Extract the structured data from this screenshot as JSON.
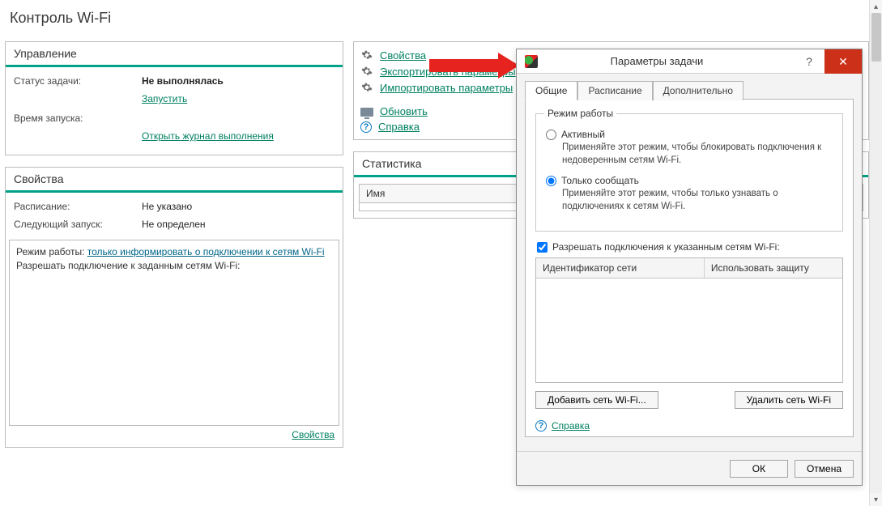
{
  "page_title": "Контроль Wi-Fi",
  "management": {
    "title": "Управление",
    "status_label": "Статус задачи:",
    "status_value": "Не выполнялась",
    "run_link": "Запустить",
    "start_label": "Время запуска:",
    "log_link": "Открыть журнал выполнения"
  },
  "properties_panel": {
    "title": "Свойства",
    "schedule_label": "Расписание:",
    "schedule_value": "Не указано",
    "next_label": "Следующий запуск:",
    "next_value": "Не определен",
    "mode_prefix": "Режим работы: ",
    "mode_value": "только информировать о подключении к сетям Wi-Fi",
    "allow_line": "Разрешать подключение к заданным сетям Wi-Fi:",
    "properties_link": "Свойства"
  },
  "actions": {
    "properties": "Свойства",
    "export": "Экспортировать параметры",
    "import": "Импортировать параметры",
    "refresh": "Обновить",
    "help": "Справка"
  },
  "statistics": {
    "title": "Статистика",
    "col_name": "Имя"
  },
  "dialog": {
    "title": "Параметры задачи",
    "tabs": {
      "general": "Общие",
      "schedule": "Расписание",
      "advanced": "Дополнительно"
    },
    "group_legend": "Режим работы",
    "radio_active": "Активный",
    "desc_active": "Применяйте этот режим, чтобы блокировать подключения к недоверенным сетям Wi-Fi.",
    "radio_report": "Только сообщать",
    "desc_report": "Применяйте этот режим, чтобы только узнавать о подключениях к сетям Wi-Fi.",
    "allow_check": "Разрешать подключения к указанным сетям Wi-Fi:",
    "grid_col1": "Идентификатор сети",
    "grid_col2": "Использовать защиту",
    "btn_add": "Добавить сеть Wi-Fi...",
    "btn_del": "Удалить сеть Wi-Fi",
    "help_link": "Справка",
    "ok": "ОК",
    "cancel": "Отмена"
  }
}
